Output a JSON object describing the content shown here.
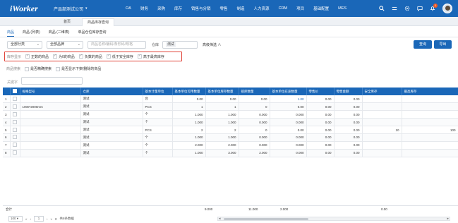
{
  "app": {
    "logo": "iWorker",
    "company": "产品部测试公司"
  },
  "nav": {
    "items": [
      "OA",
      "财务",
      "采购",
      "库存",
      "销售与分销",
      "零售",
      "制造",
      "人力资源",
      "CRM",
      "项目",
      "基础配置",
      "MES"
    ],
    "notification_count": "1"
  },
  "pagetabs": {
    "home": "首页",
    "active": "商品库存查询"
  },
  "subtabs": [
    "商品",
    "商品 (列表)",
    "商品 (二维表)",
    "单品仓位库存查询"
  ],
  "filters": {
    "category": "全部分类",
    "brand": "全部品牌",
    "search_placeholder": "商品名称/编码/条形码/规格",
    "warehouse_label": "仓库",
    "warehouse_value": "测试",
    "advanced": "高级筛选 ∧",
    "query_button": "查询",
    "export_button": "导出"
  },
  "stock_display": {
    "title": "库存显示",
    "options": [
      "正数的商品",
      "为0的商品",
      "负数的商品",
      "低于安全库存",
      "高于最高库存"
    ]
  },
  "search_mode": {
    "title": "商品搜索",
    "options": [
      "是否精确搜索",
      "是否显示下架/删除的商品"
    ]
  },
  "keyword_label": "关键字",
  "table": {
    "columns": [
      "",
      "规格型号",
      "仓库",
      "基本计量单位",
      "基本单位可用数量",
      "基本单位库存数量",
      "锁库数量",
      "基本单位在途数量",
      "零售价",
      "零售金额",
      "安全库存",
      "最高库存"
    ],
    "rows": [
      [
        "1",
        "",
        "测试",
        "台",
        "0.00",
        "0.00",
        "0.00",
        "1.00",
        "0.00",
        "0.00",
        "",
        ""
      ],
      [
        "2",
        "1000*2000mm",
        "测试",
        "PCS",
        "1",
        "1",
        "0",
        "0.00",
        "0.00",
        "0.00",
        "",
        ""
      ],
      [
        "3",
        "",
        "测试",
        "个",
        "1.000",
        "1.000",
        "0.000",
        "0.000",
        "0.00",
        "0.00",
        "",
        ""
      ],
      [
        "4",
        "",
        "测试",
        "个",
        "1.000",
        "1.000",
        "0.000",
        "0.000",
        "0.00",
        "0.00",
        "",
        ""
      ],
      [
        "5",
        "",
        "测试",
        "PCS",
        "2",
        "2",
        "0",
        "0.00",
        "0.00",
        "0.00",
        "10",
        "100"
      ],
      [
        "6",
        "",
        "测试",
        "个",
        "1.000",
        "1.000",
        "0.000",
        "0.000",
        "0.00",
        "0.00",
        "",
        ""
      ],
      [
        "7",
        "",
        "测试",
        "个",
        "2.000",
        "2.000",
        "0.000",
        "0.000",
        "0.00",
        "0.00",
        "",
        ""
      ],
      [
        "8",
        "",
        "测试",
        "个",
        "1.000",
        "3.000",
        "2.000",
        "0.000",
        "0.00",
        "0.00",
        "",
        ""
      ]
    ]
  },
  "totals": {
    "label": "合计",
    "avail": "9.000",
    "stock": "11.000",
    "locked": "2.000",
    "amount": "0.00"
  },
  "pager": {
    "page_size": "100",
    "page": "1",
    "total_pages": "0",
    "total_text": "共8条数据"
  },
  "colors": {
    "brand": "#1a67b8",
    "highlight": "#e0443a"
  }
}
